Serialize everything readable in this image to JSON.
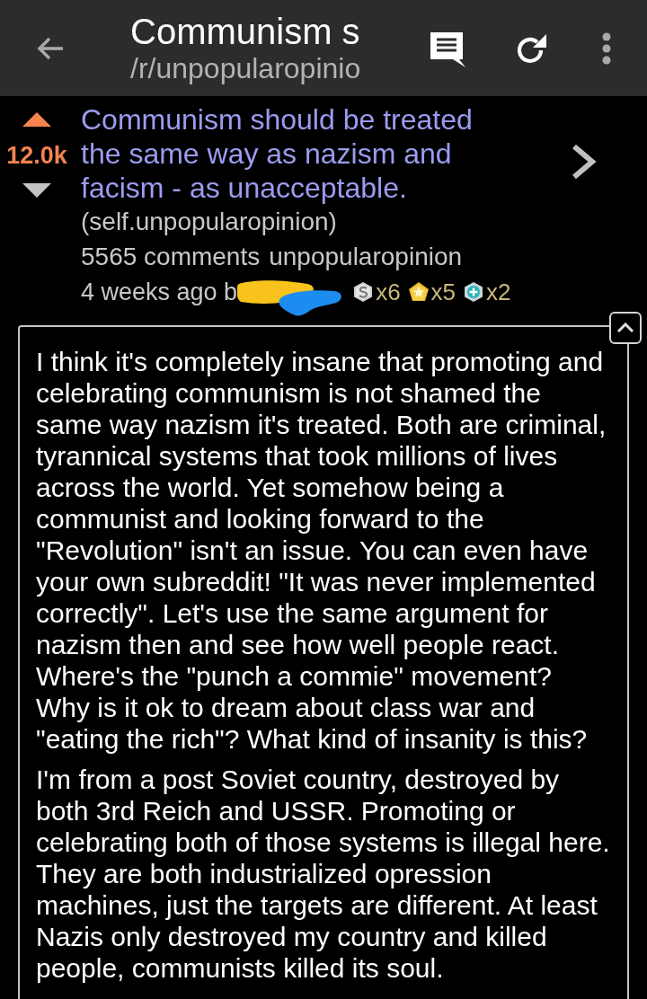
{
  "toolbar": {
    "title": "Communism s",
    "subtitle": "/r/unpopularopinio"
  },
  "post": {
    "upvoted": true,
    "score": "12.0k",
    "title": "Communism should be treated the same way as nazism and facism - as unacceptable.",
    "domain": "(self.unpopularopinion)",
    "comments": "5565 comments",
    "subreddit": "unpopularopinion",
    "byline": "4 weeks ago b",
    "awards": [
      {
        "kind": "silver",
        "count": "x6"
      },
      {
        "kind": "gold",
        "count": "x5"
      },
      {
        "kind": "platinum",
        "count": "x2"
      }
    ]
  },
  "selftext": {
    "expanded": true,
    "paragraphs": [
      "I think it's completely insane that promoting and celebrating communism is not shamed the same way nazism it's treated. Both are criminal, tyrannical systems that took millions of lives across the world. Yet somehow being a communist and looking forward to the \"Revolution\" isn't an issue. You can even have your own subreddit! \"It was never implemented correctly\". Let's use the same argument for nazism then and see how well people react. Where's the \"punch a commie\" movement? Why is it ok to dream about class war and \"eating the rich\"? What kind of insanity is this?",
      "I'm from a post Soviet country, destroyed by both 3rd Reich and USSR. Promoting or celebrating both of those systems is illegal here. They are both industrialized opression machines, just the targets are different. At least Nazis only destroyed my country and killed people, communists killed its soul."
    ]
  }
}
